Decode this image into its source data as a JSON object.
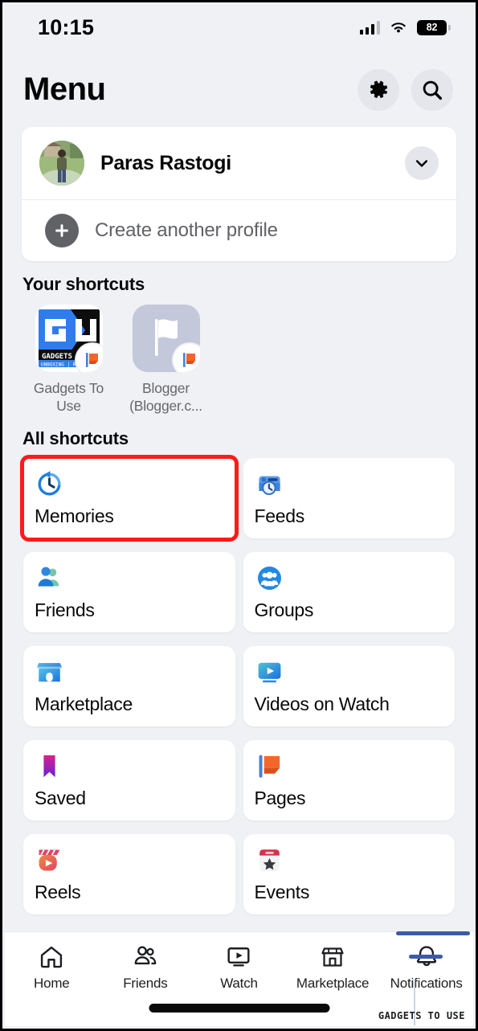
{
  "status_bar": {
    "time": "10:15",
    "battery_percent": "82",
    "signal_icon": "cellular-signal-icon",
    "wifi_icon": "wifi-icon",
    "battery_icon": "battery-icon"
  },
  "header": {
    "title": "Menu",
    "settings_icon": "gear-icon",
    "search_icon": "search-icon"
  },
  "profile": {
    "name": "Paras Rastogi",
    "avatar_icon": "avatar",
    "expand_icon": "chevron-down-icon",
    "create_label": "Create another profile",
    "plus_icon": "plus-icon"
  },
  "your_shortcuts": {
    "heading": "Your shortcuts",
    "items": [
      {
        "label": "Gadgets To Use",
        "logo_text": "GU",
        "logo_sub": "GADGETS TO",
        "logo_sub2": "UNBOXING | REVIEW |",
        "badge_icon": "pages-flag-icon",
        "type": "page-thumb"
      },
      {
        "label": "Blogger (Blogger.c...",
        "badge_icon": "pages-flag-icon",
        "type": "flag-thumb"
      }
    ]
  },
  "all_shortcuts": {
    "heading": "All shortcuts",
    "items": [
      {
        "label": "Memories",
        "icon": "memories-clock-icon",
        "highlighted": true
      },
      {
        "label": "Feeds",
        "icon": "feeds-icon",
        "highlighted": false
      },
      {
        "label": "Friends",
        "icon": "friends-people-icon",
        "highlighted": false
      },
      {
        "label": "Groups",
        "icon": "groups-circle-icon",
        "highlighted": false
      },
      {
        "label": "Marketplace",
        "icon": "marketplace-shop-icon",
        "highlighted": false
      },
      {
        "label": "Videos on Watch",
        "icon": "watch-video-icon",
        "highlighted": false
      },
      {
        "label": "Saved",
        "icon": "saved-bookmark-icon",
        "highlighted": false
      },
      {
        "label": "Pages",
        "icon": "pages-flag-icon",
        "highlighted": false
      },
      {
        "label": "Reels",
        "icon": "reels-icon",
        "highlighted": false
      },
      {
        "label": "Events",
        "icon": "events-calendar-icon",
        "highlighted": false
      }
    ]
  },
  "bottom_nav": {
    "items": [
      {
        "label": "Home",
        "icon": "home-icon"
      },
      {
        "label": "Friends",
        "icon": "friends-icon"
      },
      {
        "label": "Watch",
        "icon": "watch-icon"
      },
      {
        "label": "Marketplace",
        "icon": "marketplace-icon"
      },
      {
        "label": "Notifications",
        "icon": "bell-icon"
      }
    ],
    "active_tab": "Menu"
  },
  "watermark": "GADGETS TO USE",
  "colors": {
    "background": "#eff1f5",
    "card": "#ffffff",
    "accent_blue": "#1877f2",
    "highlight_red": "#ff1a1a",
    "nav_active": "#3b5ba5",
    "text_primary": "#080809",
    "text_secondary": "#65676b"
  }
}
